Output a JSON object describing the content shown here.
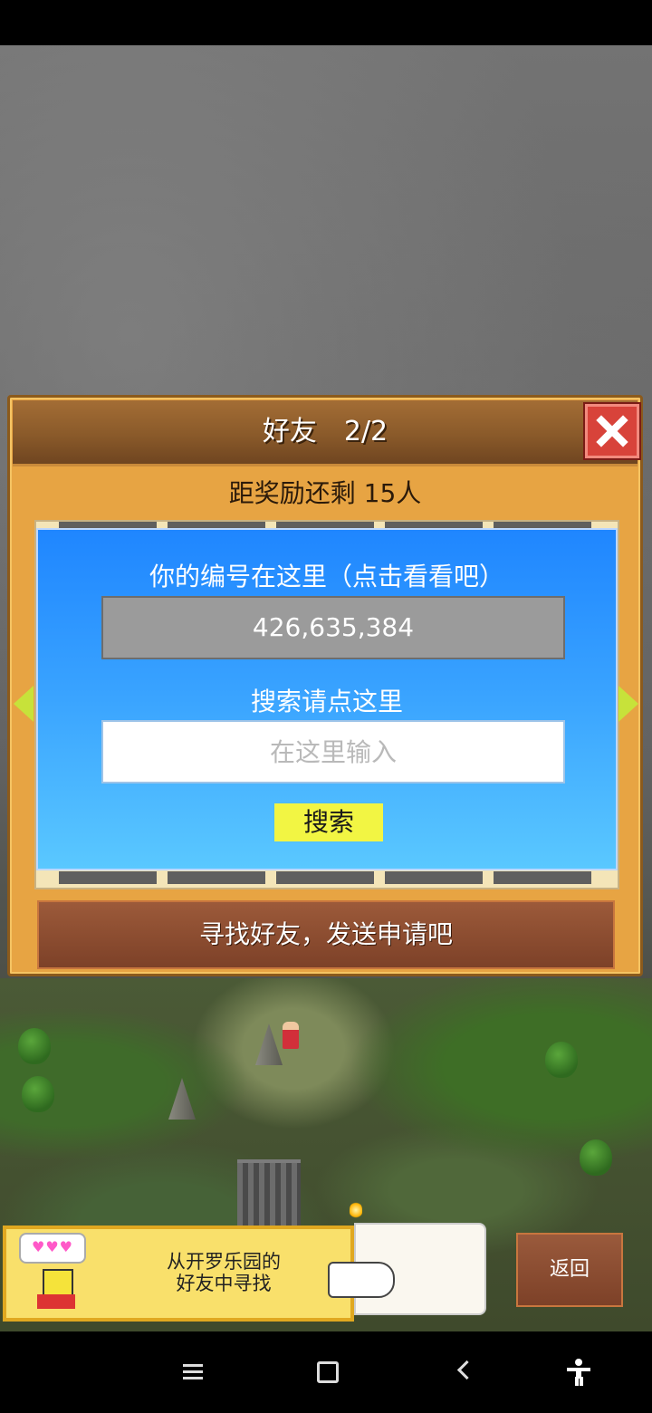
{
  "dialog": {
    "title": "好友　2/2",
    "reward_text": "距奖励还剩 15人",
    "id_label": "你的编号在这里（点击看看吧）",
    "id_value": "426,635,384",
    "search_label": "搜索请点这里",
    "search_placeholder": "在这里输入",
    "search_value": "",
    "search_button": "搜索",
    "find_friends": "寻找好友，发送申请吧"
  },
  "banner": {
    "avatar_bubble": "♥♥♥",
    "text": "从开罗乐园的\n好友中寻找"
  },
  "back_button": "返回",
  "colors": {
    "panel_blue": "#1f86ff",
    "frame_orange": "#e7a443",
    "close_red": "#d8433a",
    "search_yellow": "#f2f543",
    "brown_button": "#7d4128"
  },
  "icons": [
    "close-icon",
    "arrow-left-icon",
    "arrow-right-icon",
    "hand-pointer-icon",
    "menu-icon",
    "home-icon",
    "back-icon",
    "accessibility-icon"
  ]
}
